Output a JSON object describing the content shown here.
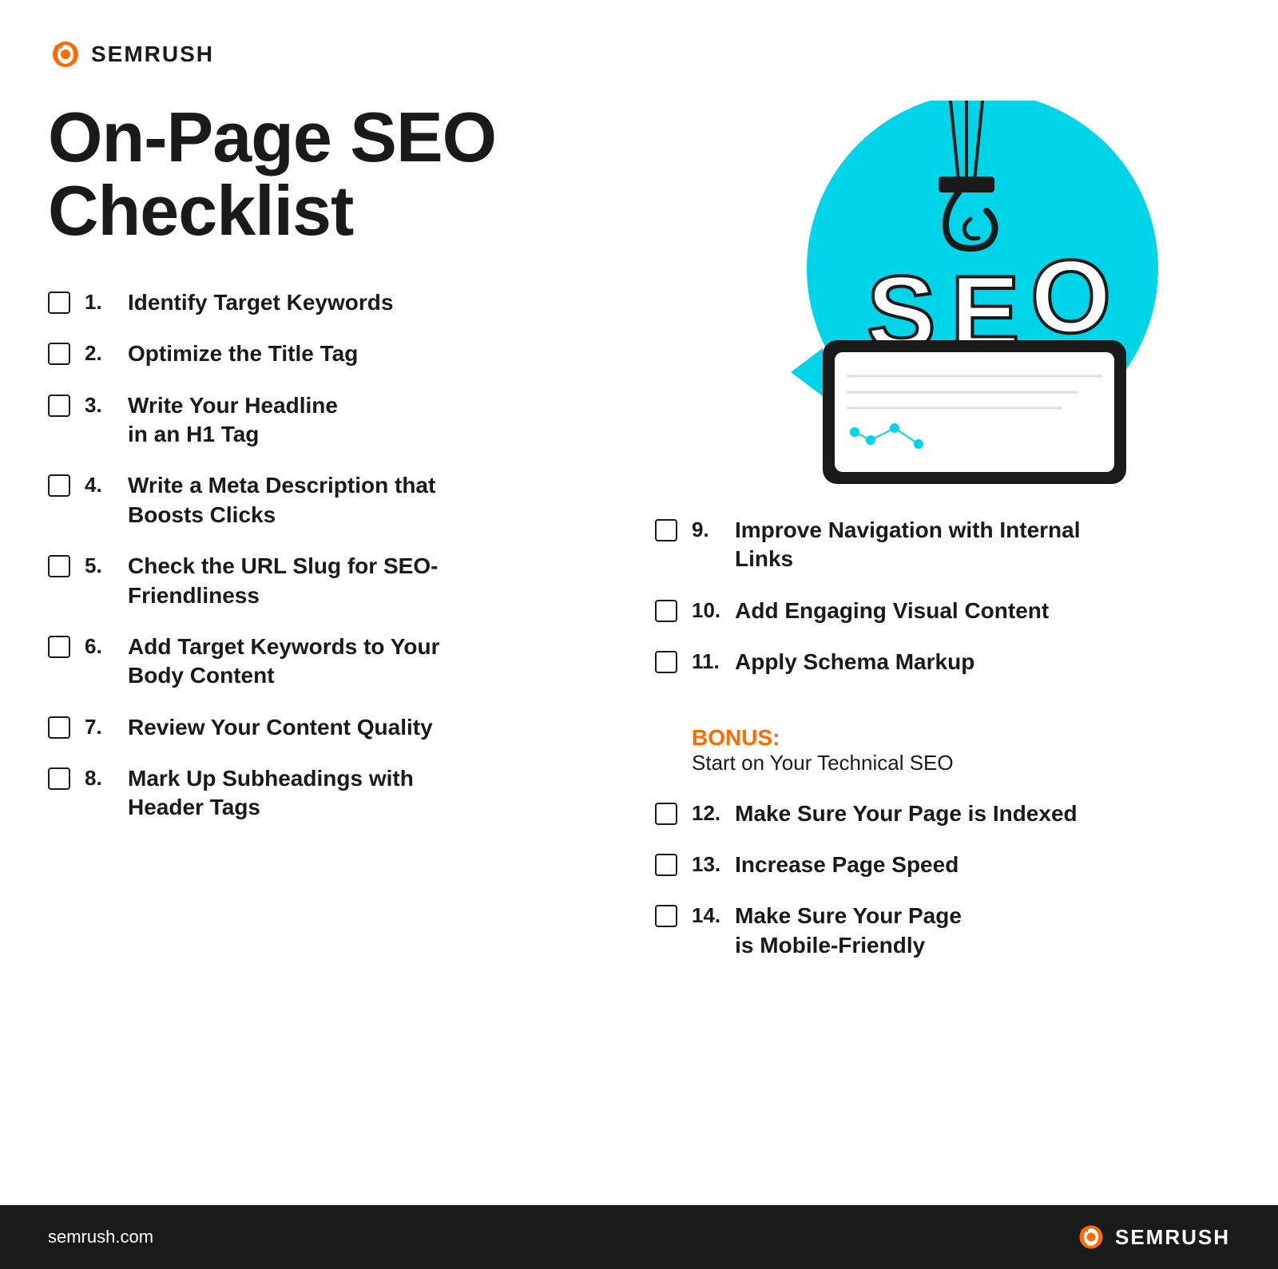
{
  "logo": {
    "text": "SEMRUSH",
    "url": "semrush.com"
  },
  "title": {
    "line1": "On-Page SEO",
    "line2": "Checklist"
  },
  "left_items": [
    {
      "number": "1.",
      "text": "Identify Target Keywords"
    },
    {
      "number": "2.",
      "text": "Optimize the Title Tag"
    },
    {
      "number": "3.",
      "text": "Write Your Headline\nin an H1 Tag"
    },
    {
      "number": "4.",
      "text": "Write a Meta Description that\nBoosts Clicks"
    },
    {
      "number": "5.",
      "text": "Check the URL Slug for SEO-\nFriendliness"
    },
    {
      "number": "6.",
      "text": "Add Target Keywords to Your\nBody Content"
    },
    {
      "number": "7.",
      "text": "Review Your Content Quality"
    },
    {
      "number": "8.",
      "text": "Mark Up Subheadings with\nHeader Tags"
    }
  ],
  "right_items": [
    {
      "number": "9.",
      "text": "Improve Navigation with Internal\nLinks"
    },
    {
      "number": "10.",
      "text": "Add Engaging Visual Content"
    },
    {
      "number": "11.",
      "text": "Apply Schema Markup"
    }
  ],
  "bonus": {
    "label": "BONUS:",
    "subtitle": "Start on Your Technical SEO"
  },
  "bonus_items": [
    {
      "number": "12.",
      "text": "Make Sure Your Page is Indexed"
    },
    {
      "number": "13.",
      "text": "Increase Page Speed"
    },
    {
      "number": "14.",
      "text": "Make Sure Your Page\nis Mobile-Friendly"
    }
  ]
}
